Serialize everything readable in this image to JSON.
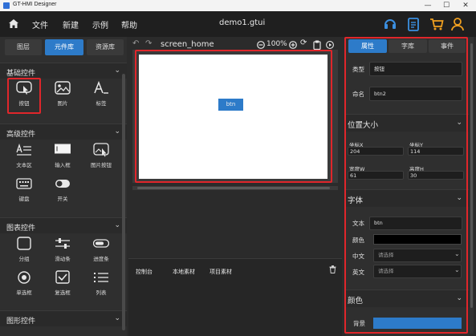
{
  "window": {
    "title": "GT-HMI Designer",
    "file": "demo1.gtui"
  },
  "menu": [
    "文件",
    "新建",
    "示例",
    "帮助"
  ],
  "left_tabs": {
    "layers": "图层",
    "widgets": "元件库",
    "resources": "资源库"
  },
  "sections": {
    "basic": {
      "title": "基础控件",
      "items": [
        "按钮",
        "图片",
        "标签"
      ]
    },
    "advanced": {
      "title": "高级控件",
      "items": [
        "文本区",
        "输入框",
        "图片按钮",
        "键盘",
        "开关"
      ]
    },
    "chart": {
      "title": "图表控件",
      "items": [
        "分组",
        "滑动条",
        "进度条",
        "单选框",
        "复选框",
        "列表"
      ]
    },
    "graphics": {
      "title": "图形控件"
    }
  },
  "canvas": {
    "screen_name": "screen_home",
    "zoom": "100%",
    "button_label": "btn"
  },
  "console_tabs": [
    "控制台",
    "本地素材",
    "项目素材"
  ],
  "right_tabs": {
    "props": "属性",
    "fonts": "字库",
    "events": "事件"
  },
  "props": {
    "type_label": "类型",
    "type_value": "按钮",
    "name_label": "命名",
    "name_value": "btn2",
    "posize_title": "位置大小",
    "x_label": "坐标X",
    "x_value": "204",
    "y_label": "坐标Y",
    "y_value": "114",
    "w_label": "宽度W",
    "w_value": "61",
    "h_label": "高度H",
    "h_value": "30",
    "font_title": "字体",
    "text_label": "文本",
    "text_value": "btn",
    "color_label": "颜色",
    "zh_label": "中文",
    "zh_placeholder": "请选择",
    "en_label": "英文",
    "en_placeholder": "请选择",
    "color_title": "颜色",
    "bg_label": "背景"
  },
  "colors": {
    "accent": "#2d7bc9",
    "highlight_box": "#e0262b",
    "icon_orange": "#f0a020",
    "icon_blue": "#3b8fe0"
  }
}
